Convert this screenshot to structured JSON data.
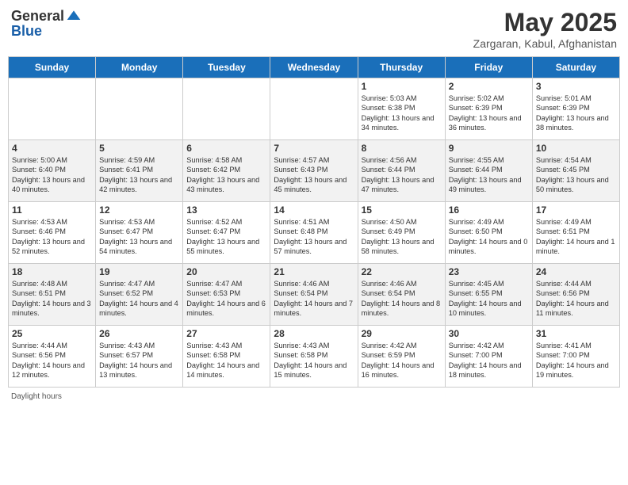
{
  "header": {
    "logo_general": "General",
    "logo_blue": "Blue",
    "title": "May 2025",
    "location": "Zargaran, Kabul, Afghanistan"
  },
  "days": [
    "Sunday",
    "Monday",
    "Tuesday",
    "Wednesday",
    "Thursday",
    "Friday",
    "Saturday"
  ],
  "weeks": [
    [
      {
        "num": "",
        "sunrise": "",
        "sunset": "",
        "daylight": ""
      },
      {
        "num": "",
        "sunrise": "",
        "sunset": "",
        "daylight": ""
      },
      {
        "num": "",
        "sunrise": "",
        "sunset": "",
        "daylight": ""
      },
      {
        "num": "",
        "sunrise": "",
        "sunset": "",
        "daylight": ""
      },
      {
        "num": "1",
        "sunrise": "Sunrise: 5:03 AM",
        "sunset": "Sunset: 6:38 PM",
        "daylight": "Daylight: 13 hours and 34 minutes."
      },
      {
        "num": "2",
        "sunrise": "Sunrise: 5:02 AM",
        "sunset": "Sunset: 6:39 PM",
        "daylight": "Daylight: 13 hours and 36 minutes."
      },
      {
        "num": "3",
        "sunrise": "Sunrise: 5:01 AM",
        "sunset": "Sunset: 6:39 PM",
        "daylight": "Daylight: 13 hours and 38 minutes."
      }
    ],
    [
      {
        "num": "4",
        "sunrise": "Sunrise: 5:00 AM",
        "sunset": "Sunset: 6:40 PM",
        "daylight": "Daylight: 13 hours and 40 minutes."
      },
      {
        "num": "5",
        "sunrise": "Sunrise: 4:59 AM",
        "sunset": "Sunset: 6:41 PM",
        "daylight": "Daylight: 13 hours and 42 minutes."
      },
      {
        "num": "6",
        "sunrise": "Sunrise: 4:58 AM",
        "sunset": "Sunset: 6:42 PM",
        "daylight": "Daylight: 13 hours and 43 minutes."
      },
      {
        "num": "7",
        "sunrise": "Sunrise: 4:57 AM",
        "sunset": "Sunset: 6:43 PM",
        "daylight": "Daylight: 13 hours and 45 minutes."
      },
      {
        "num": "8",
        "sunrise": "Sunrise: 4:56 AM",
        "sunset": "Sunset: 6:44 PM",
        "daylight": "Daylight: 13 hours and 47 minutes."
      },
      {
        "num": "9",
        "sunrise": "Sunrise: 4:55 AM",
        "sunset": "Sunset: 6:44 PM",
        "daylight": "Daylight: 13 hours and 49 minutes."
      },
      {
        "num": "10",
        "sunrise": "Sunrise: 4:54 AM",
        "sunset": "Sunset: 6:45 PM",
        "daylight": "Daylight: 13 hours and 50 minutes."
      }
    ],
    [
      {
        "num": "11",
        "sunrise": "Sunrise: 4:53 AM",
        "sunset": "Sunset: 6:46 PM",
        "daylight": "Daylight: 13 hours and 52 minutes."
      },
      {
        "num": "12",
        "sunrise": "Sunrise: 4:53 AM",
        "sunset": "Sunset: 6:47 PM",
        "daylight": "Daylight: 13 hours and 54 minutes."
      },
      {
        "num": "13",
        "sunrise": "Sunrise: 4:52 AM",
        "sunset": "Sunset: 6:47 PM",
        "daylight": "Daylight: 13 hours and 55 minutes."
      },
      {
        "num": "14",
        "sunrise": "Sunrise: 4:51 AM",
        "sunset": "Sunset: 6:48 PM",
        "daylight": "Daylight: 13 hours and 57 minutes."
      },
      {
        "num": "15",
        "sunrise": "Sunrise: 4:50 AM",
        "sunset": "Sunset: 6:49 PM",
        "daylight": "Daylight: 13 hours and 58 minutes."
      },
      {
        "num": "16",
        "sunrise": "Sunrise: 4:49 AM",
        "sunset": "Sunset: 6:50 PM",
        "daylight": "Daylight: 14 hours and 0 minutes."
      },
      {
        "num": "17",
        "sunrise": "Sunrise: 4:49 AM",
        "sunset": "Sunset: 6:51 PM",
        "daylight": "Daylight: 14 hours and 1 minute."
      }
    ],
    [
      {
        "num": "18",
        "sunrise": "Sunrise: 4:48 AM",
        "sunset": "Sunset: 6:51 PM",
        "daylight": "Daylight: 14 hours and 3 minutes."
      },
      {
        "num": "19",
        "sunrise": "Sunrise: 4:47 AM",
        "sunset": "Sunset: 6:52 PM",
        "daylight": "Daylight: 14 hours and 4 minutes."
      },
      {
        "num": "20",
        "sunrise": "Sunrise: 4:47 AM",
        "sunset": "Sunset: 6:53 PM",
        "daylight": "Daylight: 14 hours and 6 minutes."
      },
      {
        "num": "21",
        "sunrise": "Sunrise: 4:46 AM",
        "sunset": "Sunset: 6:54 PM",
        "daylight": "Daylight: 14 hours and 7 minutes."
      },
      {
        "num": "22",
        "sunrise": "Sunrise: 4:46 AM",
        "sunset": "Sunset: 6:54 PM",
        "daylight": "Daylight: 14 hours and 8 minutes."
      },
      {
        "num": "23",
        "sunrise": "Sunrise: 4:45 AM",
        "sunset": "Sunset: 6:55 PM",
        "daylight": "Daylight: 14 hours and 10 minutes."
      },
      {
        "num": "24",
        "sunrise": "Sunrise: 4:44 AM",
        "sunset": "Sunset: 6:56 PM",
        "daylight": "Daylight: 14 hours and 11 minutes."
      }
    ],
    [
      {
        "num": "25",
        "sunrise": "Sunrise: 4:44 AM",
        "sunset": "Sunset: 6:56 PM",
        "daylight": "Daylight: 14 hours and 12 minutes."
      },
      {
        "num": "26",
        "sunrise": "Sunrise: 4:43 AM",
        "sunset": "Sunset: 6:57 PM",
        "daylight": "Daylight: 14 hours and 13 minutes."
      },
      {
        "num": "27",
        "sunrise": "Sunrise: 4:43 AM",
        "sunset": "Sunset: 6:58 PM",
        "daylight": "Daylight: 14 hours and 14 minutes."
      },
      {
        "num": "28",
        "sunrise": "Sunrise: 4:43 AM",
        "sunset": "Sunset: 6:58 PM",
        "daylight": "Daylight: 14 hours and 15 minutes."
      },
      {
        "num": "29",
        "sunrise": "Sunrise: 4:42 AM",
        "sunset": "Sunset: 6:59 PM",
        "daylight": "Daylight: 14 hours and 16 minutes."
      },
      {
        "num": "30",
        "sunrise": "Sunrise: 4:42 AM",
        "sunset": "Sunset: 7:00 PM",
        "daylight": "Daylight: 14 hours and 18 minutes."
      },
      {
        "num": "31",
        "sunrise": "Sunrise: 4:41 AM",
        "sunset": "Sunset: 7:00 PM",
        "daylight": "Daylight: 14 hours and 19 minutes."
      }
    ]
  ],
  "footer": "Daylight hours"
}
